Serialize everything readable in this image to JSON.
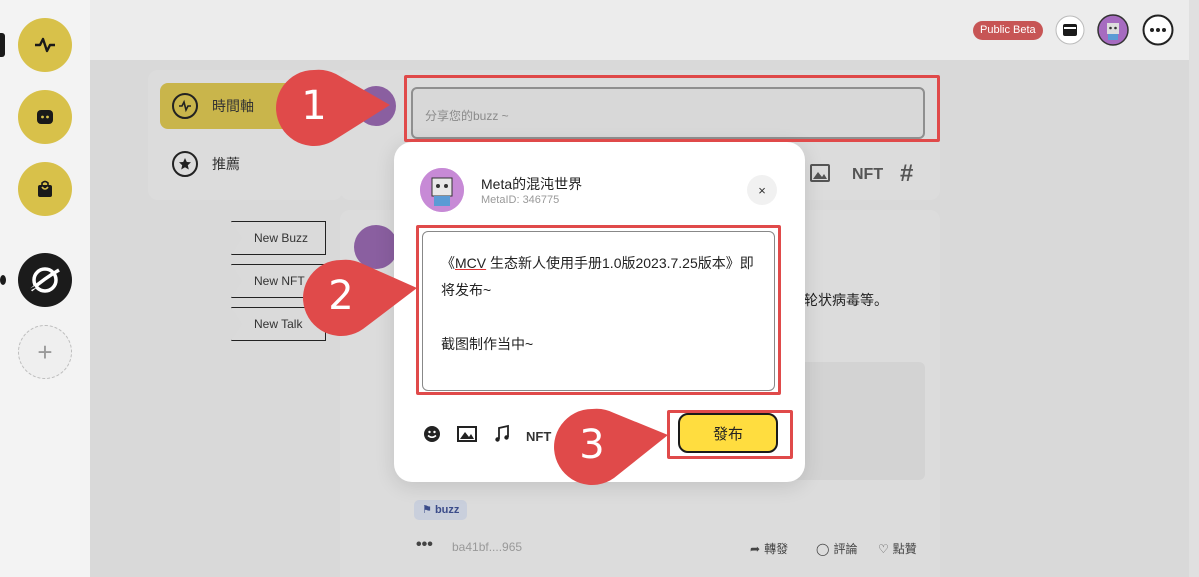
{
  "header": {
    "badge": "Public Beta"
  },
  "nav": {
    "items": [
      {
        "label": "時間軸"
      },
      {
        "label": "推薦"
      }
    ]
  },
  "create_buttons": [
    {
      "label": "New Buzz"
    },
    {
      "label": "New NFT"
    },
    {
      "label": "New Talk"
    }
  ],
  "composer": {
    "placeholder": "分享您的buzz ~",
    "nft_label": "NFT",
    "hash_label": "#"
  },
  "background_post": {
    "text_fragment": "括轮状病毒等。",
    "tag": "buzz",
    "hash": "ba41bf....965",
    "actions": [
      "轉發",
      "評論",
      "點贊"
    ]
  },
  "modal": {
    "user_name": "Meta的混沌世界",
    "meta_id": "MetaID: 346775",
    "close_label": "×",
    "line1_prefix": "《",
    "line1_underlined": "MCV",
    "line1_rest": " 生态新人使用手册1.0版2023.7.25版本》即",
    "line2": "将发布~",
    "line3": "截图制作当中~",
    "nft_label": "NFT",
    "publish_label": "發布"
  },
  "annotations": {
    "step1": "1",
    "step2": "2",
    "step3": "3"
  },
  "colors": {
    "accent_yellow": "#ffdd3f",
    "highlight_red": "#e04a4a",
    "beta_red": "#c75555"
  }
}
